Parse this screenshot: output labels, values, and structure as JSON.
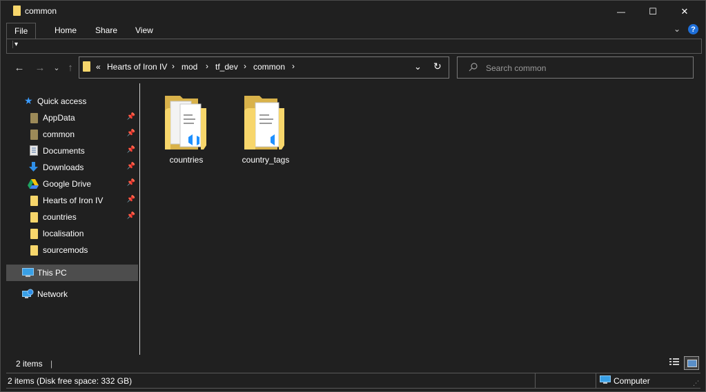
{
  "window": {
    "title": "common",
    "minimize": "—",
    "maximize": "☐",
    "close": "✕"
  },
  "ribbon": {
    "tabs": [
      "File",
      "Home",
      "Share",
      "View"
    ],
    "qat_symbol": "▾"
  },
  "nav": {
    "back": "←",
    "forward": "→",
    "recent": "⌄",
    "up": "↑"
  },
  "address": {
    "overflow": "«",
    "crumbs": [
      "Hearts of Iron IV",
      "mod",
      "tf_dev",
      "common"
    ],
    "separator": "›",
    "dropdown": "⌄",
    "refresh": "↻"
  },
  "search": {
    "placeholder": "Search common"
  },
  "sidebar": {
    "quick_access": "Quick access",
    "items": [
      {
        "label": "AppData",
        "icon": "folder-icon",
        "pinned": true
      },
      {
        "label": "common",
        "icon": "folder-icon",
        "pinned": true
      },
      {
        "label": "Documents",
        "icon": "documents-icon",
        "pinned": true
      },
      {
        "label": "Downloads",
        "icon": "downloads-icon",
        "pinned": true
      },
      {
        "label": "Google Drive",
        "icon": "google-drive-icon",
        "pinned": true
      },
      {
        "label": "Hearts of Iron IV",
        "icon": "folder-icon",
        "pinned": true
      },
      {
        "label": "countries",
        "icon": "folder-icon",
        "pinned": true
      },
      {
        "label": "localisation",
        "icon": "folder-icon",
        "pinned": false
      },
      {
        "label": "sourcemods",
        "icon": "folder-icon",
        "pinned": false
      }
    ],
    "this_pc": "This PC",
    "network": "Network"
  },
  "files": [
    {
      "name": "countries"
    },
    {
      "name": "country_tags"
    }
  ],
  "status": {
    "count": "2 items",
    "details": "2 items (Disk free space: 332 GB)",
    "location": "Computer"
  },
  "colors": {
    "background": "#202020",
    "folder": "#f7d66b",
    "accent": "#1e90ff",
    "selected": "#4d4d4d"
  }
}
